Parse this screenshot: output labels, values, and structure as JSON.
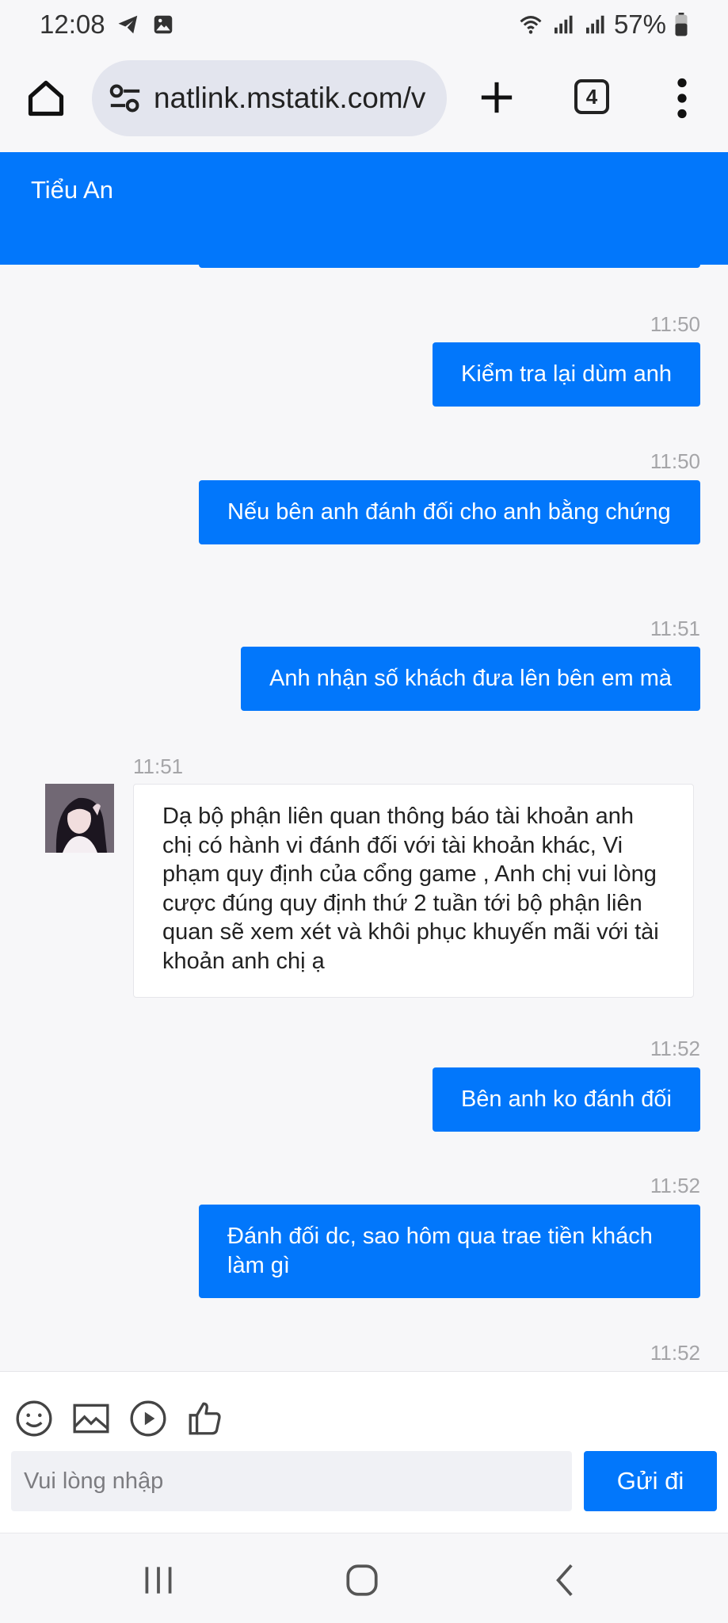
{
  "status_bar": {
    "time": "12:08",
    "battery": "57%",
    "icons": [
      "telegram-icon",
      "gallery-icon",
      "wifi-icon",
      "signal-icon",
      "signal-icon",
      "battery-icon"
    ]
  },
  "browser": {
    "url": "natlink.mstatik.com/v",
    "tab_count": "4",
    "icons": [
      "home-icon",
      "site-settings-icon",
      "plus-icon",
      "tabs-icon",
      "more-vert-icon"
    ]
  },
  "chat": {
    "title": "Tiểu An",
    "messages": [
      {
        "dir": "out",
        "time": "11:50",
        "text": "Kiểm tra lại dùm anh"
      },
      {
        "dir": "out",
        "time": "11:50",
        "text": "Nếu bên anh đánh đối cho anh bằng chứng"
      },
      {
        "dir": "out",
        "time": "11:51",
        "text": "Anh nhận số khách đưa lên bên em mà"
      },
      {
        "dir": "in",
        "time": "11:51",
        "text": "Dạ bộ phận liên quan thông báo tài khoản anh chị có hành vi đánh đối với tài khoản khác, Vi phạm quy định của cổng game , Anh chị vui lòng cược đúng quy định thứ 2 tuần tới bộ phận liên quan sẽ xem xét và khôi phục khuyến mãi với tài khoản anh chị ạ"
      },
      {
        "dir": "out",
        "time": "11:52",
        "text": "Bên anh ko đánh đối"
      },
      {
        "dir": "out",
        "time": "11:52",
        "text": "Đánh đối dc, sao hôm qua trae tiền khách làm gì"
      },
      {
        "dir": "out",
        "time": "11:52",
        "text": ""
      }
    ]
  },
  "composer": {
    "placeholder": "Vui lòng nhập",
    "send_label": "Gửi đi",
    "tools": [
      "emoji-icon",
      "image-icon",
      "video-icon",
      "like-icon"
    ]
  },
  "colors": {
    "accent": "#0277fb",
    "background": "#f7f7f9",
    "timestamp": "#a5a5a8"
  }
}
